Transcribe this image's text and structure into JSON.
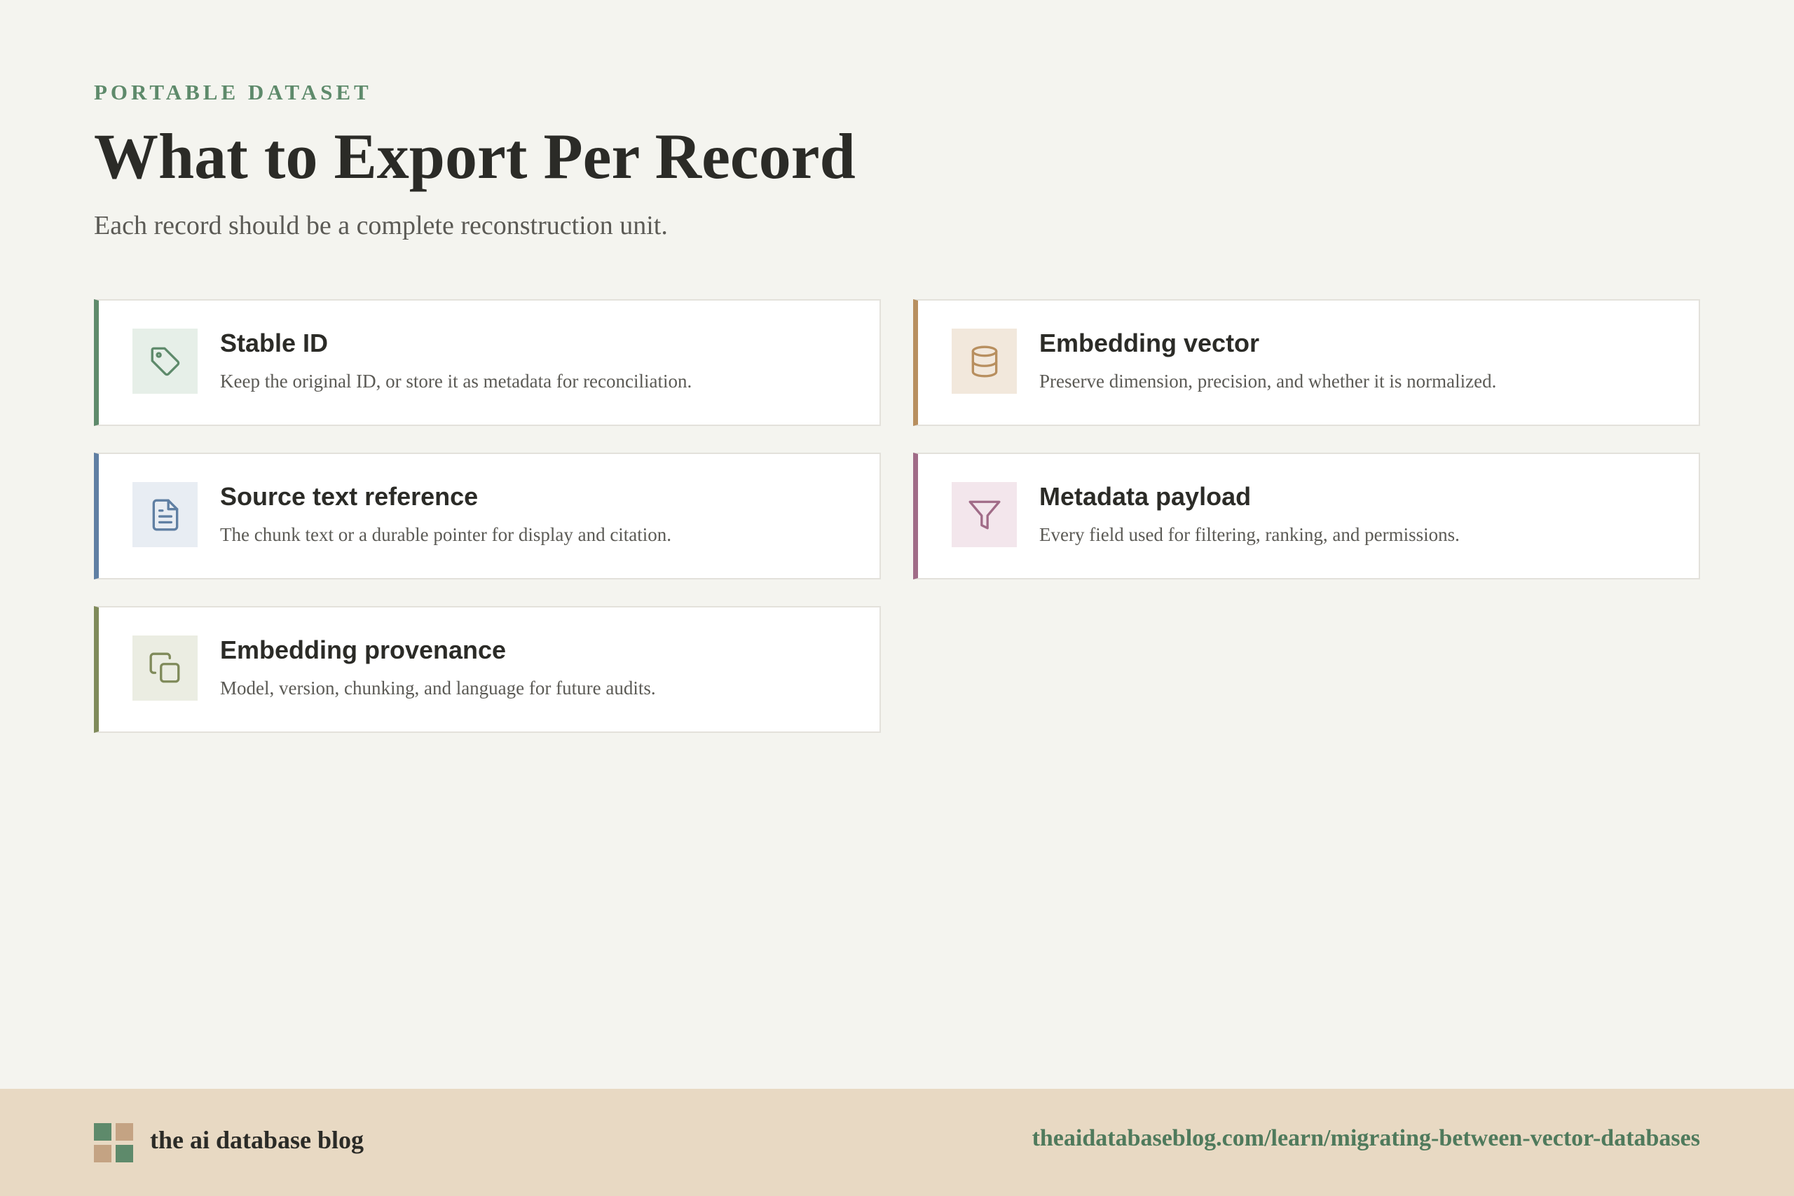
{
  "header": {
    "eyebrow": "PORTABLE DATASET",
    "title": "What to Export Per Record",
    "subtitle": "Each record should be a complete reconstruction unit."
  },
  "cards": [
    {
      "title": "Stable ID",
      "description": "Keep the original ID, or store it as metadata for reconciliation.",
      "icon": "tag-icon",
      "accent": "#5e8a6b",
      "icon_bg": "#e6efe8"
    },
    {
      "title": "Embedding vector",
      "description": "Preserve dimension, precision, and whether it is normalized.",
      "icon": "database-icon",
      "accent": "#b88f5f",
      "icon_bg": "#f2e8dc"
    },
    {
      "title": "Source text reference",
      "description": "The chunk text or a durable pointer for display and citation.",
      "icon": "file-text-icon",
      "accent": "#5f7fa3",
      "icon_bg": "#e8edf3"
    },
    {
      "title": "Metadata payload",
      "description": "Every field used for filtering, ranking, and permissions.",
      "icon": "filter-icon",
      "accent": "#a06b87",
      "icon_bg": "#f3e6ec"
    },
    {
      "title": "Embedding provenance",
      "description": "Model, version, chunking, and language for future audits.",
      "icon": "copy-icon",
      "accent": "#7f8a5a",
      "icon_bg": "#ebede2"
    }
  ],
  "footer": {
    "brand": "the ai database blog",
    "url": "theaidatabaseblog.com/learn/migrating-between-vector-databases",
    "logo_colors": [
      "#5e8a6b",
      "#c4a383",
      "#c4a383",
      "#5e8a6b"
    ]
  }
}
